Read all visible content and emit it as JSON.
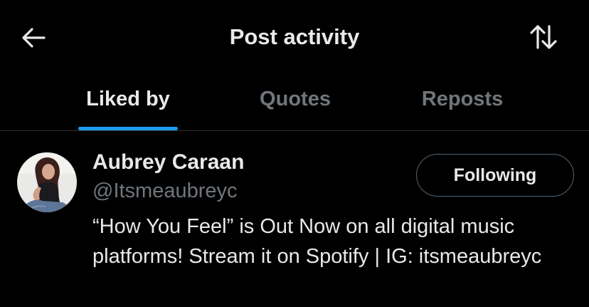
{
  "header": {
    "title": "Post activity",
    "back_icon": "arrow-left-icon",
    "sort_icon": "sort-arrows-icon"
  },
  "tabs": [
    {
      "label": "Liked by",
      "active": true
    },
    {
      "label": "Quotes",
      "active": false
    },
    {
      "label": "Reposts",
      "active": false
    }
  ],
  "users": [
    {
      "name": "Aubrey Caraan",
      "handle": "@Itsmeaubreyc",
      "follow_label": "Following",
      "bio": "“How You Feel” is Out Now on all digital music platforms! Stream it on Spotify | IG: itsmeaubreyc"
    }
  ],
  "colors": {
    "background": "#000000",
    "primary_text": "#e7e9ea",
    "secondary_text": "#71767b",
    "accent": "#1d9bf0",
    "divider": "#2f3336"
  }
}
